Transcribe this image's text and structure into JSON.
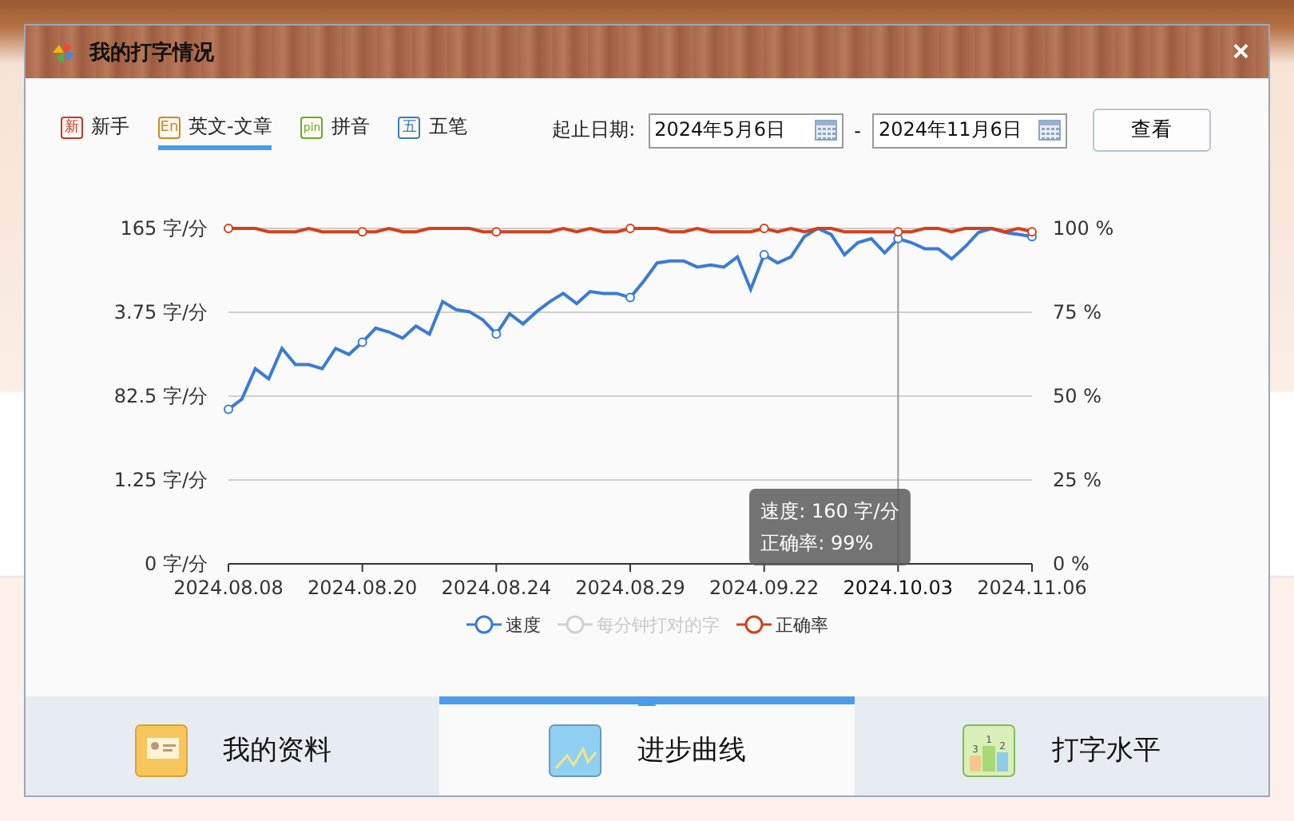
{
  "window": {
    "title": "我的打字情况",
    "close": "×"
  },
  "modes": [
    {
      "badge": "新",
      "label": "新手",
      "color": "#c0392b",
      "selected": false
    },
    {
      "badge": "En",
      "label": "英文-文章",
      "color": "#c98a2a",
      "selected": true
    },
    {
      "badge": "pin",
      "label": "拼音",
      "color": "#6aaa2a",
      "selected": false
    },
    {
      "badge": "五",
      "label": "五笔",
      "color": "#3a7cc0",
      "selected": false
    }
  ],
  "date_range": {
    "label": "起止日期:",
    "start": "2024年5月6日",
    "separator": "-",
    "end": "2024年11月6日",
    "button": "查看"
  },
  "chart": {
    "cut_y_labels": [
      "3.75 字/分",
      "1.25 字/分"
    ],
    "chart_data": {
      "type": "line",
      "categories": [
        "2024.08.08",
        null,
        null,
        null,
        null,
        null,
        null,
        null,
        null,
        null,
        "2024.08.20",
        null,
        null,
        null,
        null,
        null,
        null,
        null,
        null,
        null,
        "2024.08.24",
        null,
        null,
        null,
        null,
        null,
        null,
        null,
        null,
        null,
        "2024.08.29",
        null,
        null,
        null,
        null,
        null,
        null,
        null,
        null,
        null,
        "2024.09.22",
        null,
        null,
        null,
        null,
        null,
        null,
        null,
        null,
        null,
        "2024.10.03",
        null,
        null,
        null,
        null,
        null,
        null,
        null,
        null,
        null,
        "2024.11.06"
      ],
      "ylim": [
        0,
        165
      ],
      "yticks": [
        {
          "value": 165,
          "label": "165 字/分"
        },
        {
          "value": 82.5,
          "label": "82.5 字/分"
        },
        {
          "value": 0,
          "label": "0 字/分"
        }
      ],
      "y2lim": [
        0,
        100
      ],
      "y2ticks": [
        {
          "value": 0,
          "label": "0 %"
        },
        {
          "value": 25,
          "label": "25 %"
        },
        {
          "value": 50,
          "label": "50 %"
        },
        {
          "value": 75,
          "label": "75 %"
        },
        {
          "value": 100,
          "label": "100 %"
        }
      ],
      "series": [
        {
          "color": "#3a7bd5",
          "values": [
            76,
            81,
            96,
            91,
            106,
            98,
            98,
            96,
            106,
            103,
            109,
            116,
            114,
            111,
            117,
            113,
            129,
            125,
            124,
            120,
            113,
            123,
            118,
            124,
            129,
            133,
            128,
            134,
            133,
            133,
            131,
            139,
            148,
            149,
            149,
            146,
            147,
            146,
            151,
            135,
            152,
            148,
            151,
            161,
            165,
            162,
            152,
            158,
            160,
            153,
            160,
            158,
            155,
            155,
            150,
            156,
            163,
            165,
            163,
            162,
            161
          ]
        },
        {
          "color": "#d4401c",
          "axis": "y2",
          "values": [
            100,
            100,
            100,
            99,
            99,
            99,
            100,
            99,
            99,
            99,
            99,
            99,
            100,
            99,
            99,
            100,
            100,
            100,
            100,
            99,
            99,
            99,
            99,
            99,
            99,
            100,
            99,
            100,
            99,
            99,
            100,
            100,
            100,
            99,
            99,
            100,
            99,
            99,
            99,
            99,
            100,
            99,
            100,
            99,
            100,
            100,
            99,
            99,
            99,
            99,
            99,
            99,
            100,
            100,
            99,
            100,
            100,
            100,
            99,
            100,
            99
          ]
        }
      ],
      "grid": true,
      "annotations": [
        "速度: 160 字/分",
        "正确率: 99%"
      ]
    },
    "x_label_hovered": [
      false,
      false,
      false,
      false,
      false,
      true,
      false
    ],
    "legend": [
      {
        "label": "速度",
        "color": "#3a7bd5",
        "enabled": true
      },
      {
        "label": "每分钟打对的字",
        "color": "#d0d0d0",
        "enabled": false
      },
      {
        "label": "正确率",
        "color": "#d4401c",
        "enabled": true
      }
    ]
  },
  "bottom_tabs": [
    {
      "label": "我的资料",
      "kind": "profile",
      "selected": false
    },
    {
      "label": "进步曲线",
      "kind": "progress",
      "selected": true
    },
    {
      "label": "打字水平",
      "kind": "level",
      "digits": [
        "3",
        "1",
        "2"
      ],
      "selected": false
    }
  ]
}
